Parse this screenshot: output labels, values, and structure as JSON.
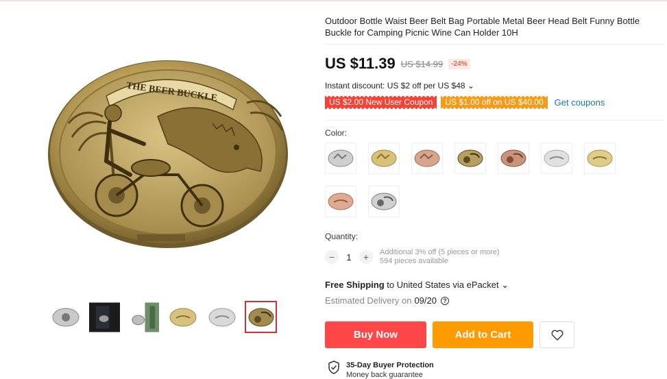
{
  "product": {
    "title": "Outdoor Bottle Waist Beer Belt Bag Portable Metal Beer Head Belt Funny Bottle Buckle for Camping Picnic Wine Can Holder 10H",
    "price": "US $11.39",
    "original_price": "US $14.99",
    "discount_badge": "-24%",
    "instant_discount": "Instant discount: US $2 off per US $48",
    "main_image_text": "THE BEER BUCKLE"
  },
  "coupons": {
    "new_user": "US $2.00 New User Coupon",
    "threshold": "US $1.00 off on US $40.00",
    "get_link": "Get coupons"
  },
  "color": {
    "label": "Color:",
    "swatches": [
      "silver-eagle",
      "gold-eagle",
      "copper-eagle",
      "bronze-biker",
      "copper-biker",
      "silver-mustache",
      "gold-mustache",
      "copper-mustache",
      "silver-biker"
    ]
  },
  "quantity": {
    "label": "Quantity:",
    "value": "1",
    "minus": "−",
    "plus": "+",
    "note_line1": "Additional 3% off (5 pieces or more)",
    "note_line2": "594 pieces available"
  },
  "shipping": {
    "bold": "Free Shipping",
    "rest": " to United States via ePacket ⌄",
    "estimated_label": "Estimated Delivery on",
    "estimated_date": "09/20",
    "help": "?"
  },
  "actions": {
    "buy_now": "Buy Now",
    "add_to_cart": "Add to Cart"
  },
  "protection": {
    "title": "35-Day Buyer Protection",
    "subtitle": "Money back guarantee"
  },
  "colors": {
    "buy": "#ff4747",
    "cart": "#ff9a00",
    "coupon_red": "#f44336",
    "coupon_orange": "#f49b1a",
    "link": "#1a73a8"
  }
}
